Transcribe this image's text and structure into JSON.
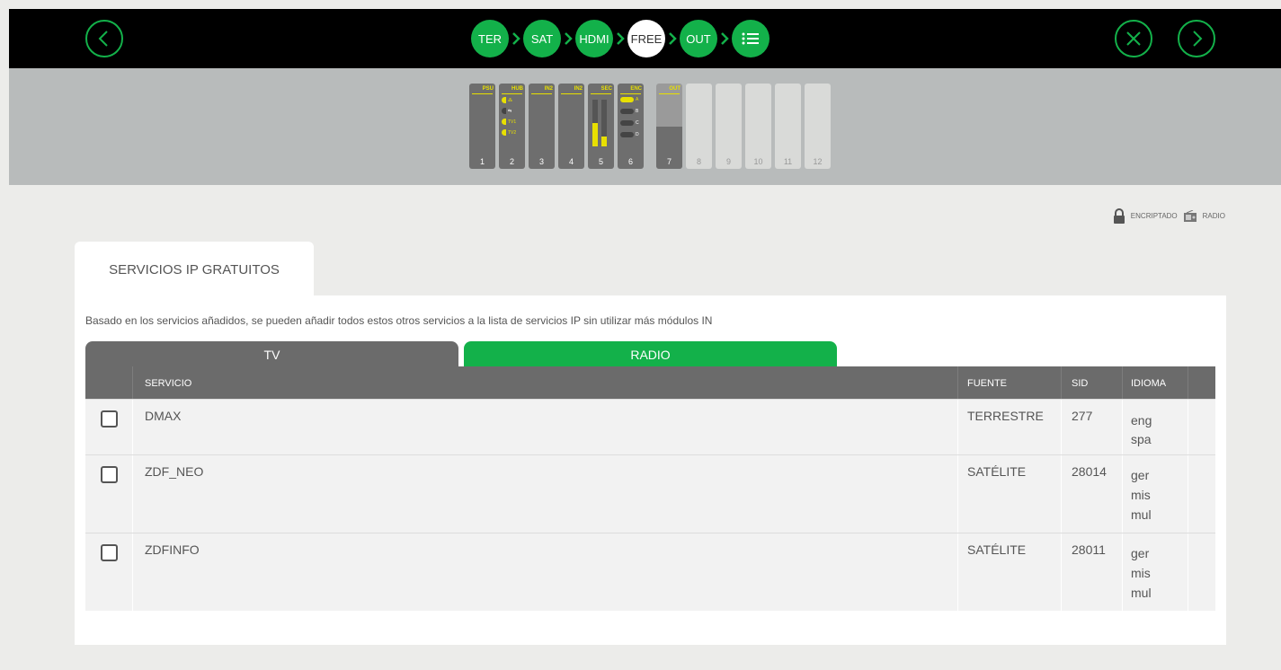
{
  "nav": {
    "back_label": "Atrás",
    "steps": [
      "TER",
      "SAT",
      "HDMI",
      "FREE",
      "OUT",
      "≡"
    ],
    "active_step": "FREE"
  },
  "modules": [
    {
      "num": "1",
      "label": "PSU"
    },
    {
      "num": "2",
      "label": "HUB"
    },
    {
      "num": "3",
      "label": "IN2"
    },
    {
      "num": "4",
      "label": "IN2"
    },
    {
      "num": "5",
      "label": "SEC"
    },
    {
      "num": "6",
      "label": "ENC"
    },
    {
      "num": "7",
      "label": "OUT"
    },
    {
      "num": "8",
      "label": ""
    },
    {
      "num": "9",
      "label": ""
    },
    {
      "num": "10",
      "label": ""
    },
    {
      "num": "11",
      "label": ""
    },
    {
      "num": "12",
      "label": ""
    }
  ],
  "hub_rows": [
    "TV1",
    "TV2"
  ],
  "enc_rows": [
    "A",
    "B",
    "C",
    "D"
  ],
  "legend": {
    "encrypted": "ENCRIPTADO",
    "radio": "RADIO"
  },
  "panel": {
    "tab_title": "SERVICIOS IP GRATUITOS",
    "description": "Basado en los servicios añadidos, se pueden añadir todos estos otros servicios a la lista de servicios IP sin utilizar más módulos IN",
    "subtabs": [
      "TV",
      "RADIO"
    ]
  },
  "table": {
    "headers": {
      "service": "SERVICIO",
      "source": "FUENTE",
      "sid": "SID",
      "language": "IDIOMA"
    },
    "rows": [
      {
        "service": "DMAX",
        "source": "TERRESTRE",
        "sid": "277",
        "languages": [
          "eng",
          "spa"
        ]
      },
      {
        "service": "ZDF_NEO",
        "source": "SATÉLITE",
        "sid": "28014",
        "languages": [
          "ger",
          "mis",
          "mul"
        ]
      },
      {
        "service": "ZDFINFO",
        "source": "SATÉLITE",
        "sid": "28011",
        "languages": [
          "ger",
          "mis",
          "mul"
        ]
      }
    ]
  },
  "colors": {
    "accent": "#13b14a",
    "yellow": "#e8e000",
    "header_gray": "#6b6b6b"
  }
}
